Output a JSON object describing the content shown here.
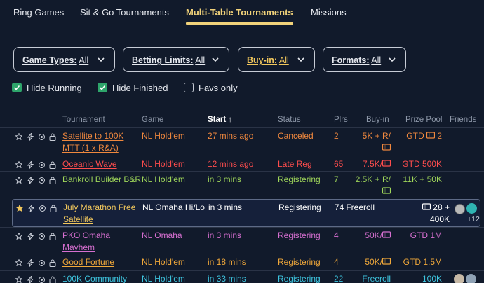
{
  "tabs": [
    {
      "label": "Ring Games",
      "active": false
    },
    {
      "label": "Sit & Go Tournaments",
      "active": false
    },
    {
      "label": "Multi-Table Tournaments",
      "active": true
    },
    {
      "label": "Missions",
      "active": false
    }
  ],
  "filters": [
    {
      "label": "Game Types:",
      "value": "All"
    },
    {
      "label": "Betting Limits:",
      "value": "All"
    },
    {
      "label": "Buy-in:",
      "value": "All"
    },
    {
      "label": "Formats:",
      "value": "All"
    }
  ],
  "checkboxes": [
    {
      "label": "Hide Running",
      "checked": true
    },
    {
      "label": "Hide Finished",
      "checked": true
    },
    {
      "label": "Favs only",
      "checked": false
    }
  ],
  "columns": [
    "Tournament",
    "Game",
    "Start",
    "Status",
    "Plrs",
    "Buy-in",
    "Prize Pool",
    "Friends"
  ],
  "sort_indicator": "↑",
  "rows": [
    {
      "name1": "Satellite to 100K",
      "name2": "MTT (1 x R&A)",
      "game": "NL Hold'em",
      "start": "27 mins ago",
      "status": "Canceled",
      "plrs": "2",
      "buyin1": "5K + R/",
      "buyin_icon": "ticket",
      "prize1": "GTD",
      "prize_ticket": "2",
      "color": "#f0883e",
      "starred": false
    },
    {
      "name1": "Oceanic Wave",
      "game": "NL Hold'em",
      "start": "12 mins ago",
      "status": "Late Reg",
      "plrs": "65",
      "buyin1": "7.5K/",
      "buyin_icon": "ticket",
      "prize1": "GTD 500K",
      "color": "#ff4d4d",
      "starred": false
    },
    {
      "name1": "Bankroll Builder B&R",
      "game": "NL Hold'em",
      "start": "in 3 mins",
      "status": "Registering",
      "plrs": "7",
      "buyin1": "2.5K + R/",
      "buyin_icon": "ticket",
      "prize1": "11K + 50K",
      "color": "#9fd65a",
      "starred": false
    },
    {
      "name1": "July Marathon Free",
      "name2": "Satellite",
      "game": "NL Omaha Hi/Lo",
      "start": "in 3 mins",
      "status": "Registering",
      "plrs": "74",
      "buyin1": "Freeroll",
      "prize1": "28 +",
      "prize2": "400K",
      "prize_icon": "ticket",
      "color": "#f1c75d",
      "starred": true,
      "friends_more": "+12"
    },
    {
      "name1": "PKO Omaha",
      "name2": "Mayhem",
      "game": "NL Omaha",
      "start": "in 3 mins",
      "status": "Registering",
      "plrs": "4",
      "buyin1": "50K/",
      "buyin_icon": "ticket",
      "prize1": "GTD 1M",
      "color": "#d66fd0",
      "starred": false
    },
    {
      "name1": "Good Fortune",
      "game": "NL Hold'em",
      "start": "in 18 mins",
      "status": "Registering",
      "plrs": "4",
      "buyin1": "50K/",
      "buyin_icon": "ticket",
      "prize1": "GTD 1.5M",
      "color": "#f0a83a",
      "starred": false
    },
    {
      "name1": "100K Community",
      "game": "NL Hold'em",
      "start": "in 33 mins",
      "status": "Registering",
      "plrs": "22",
      "buyin1": "Freeroll",
      "prize1": "100K",
      "color": "#3ec6e0",
      "starred": false
    }
  ],
  "colors": {
    "accent": "#f1d27a",
    "check": "#2ea56b",
    "background": "#111a2b"
  }
}
